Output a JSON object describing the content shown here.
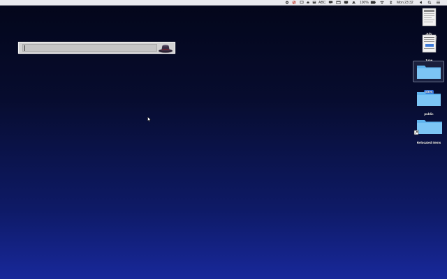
{
  "menubar": {
    "input_badge": "ABC",
    "battery": "100%",
    "clock": "Mon 23:32"
  },
  "launcher": {
    "query": "",
    "placeholder": ""
  },
  "desktop_icons": [
    {
      "id": "july",
      "label": "July",
      "kind": "document"
    },
    {
      "id": "june",
      "label": "June",
      "kind": "document"
    },
    {
      "id": "selected-folder",
      "label": "Sites",
      "kind": "folder",
      "selected": true
    },
    {
      "id": "public",
      "label": "public",
      "kind": "folder"
    },
    {
      "id": "relocated-items",
      "label": "Relocated Items",
      "kind": "folder-alias"
    }
  ],
  "colors": {
    "folder": "#5fb4ee",
    "folder_tab": "#7cc5f5",
    "selection": "#2b6fe0",
    "menubar": "#e9e9ee"
  }
}
